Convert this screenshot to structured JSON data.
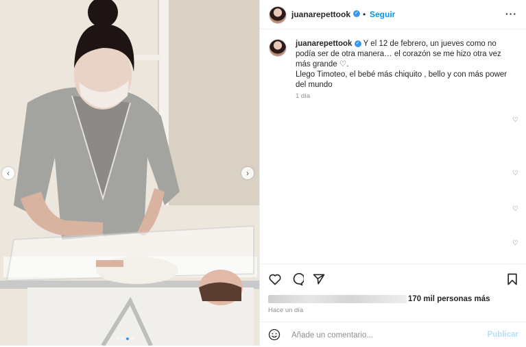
{
  "photo": {
    "prev_icon": "chevron-left-icon",
    "next_icon": "chevron-right-icon",
    "carousel": {
      "total": 4,
      "active_index": 2
    },
    "colors": {
      "wall": "#e9e2d8",
      "robe": "#9a9a9a",
      "hair": "#1e1414",
      "blanket": "#f5f3f0"
    }
  },
  "header": {
    "username": "juanarepettook",
    "verified_icon": "verified-badge-icon",
    "separator": "•",
    "follow_label": "Seguir",
    "more_label": "···"
  },
  "caption": {
    "username": "juanarepettook",
    "text_line1": "Y el 12 de febrero, un jueves como no podía ser de otra manera… el corazón se me hizo otra vez más grande ♡.",
    "text_line2": "Llego Timoteo, el bebé más chiquito , bello y con más power del mundo",
    "time": "1 día"
  },
  "comments": {
    "like_icon": "heart-outline-icon"
  },
  "actions": {
    "like_icon": "heart-icon",
    "comment_icon": "comment-icon",
    "share_icon": "share-icon",
    "save_icon": "bookmark-icon",
    "likes_text": "170 mil personas más",
    "time": "Hace un día"
  },
  "comment_bar": {
    "emoji_icon": "emoji-icon",
    "placeholder": "Añade un comentario...",
    "publish_label": "Publicar"
  },
  "colors": {
    "accent": "#0095f6",
    "verified": "#3897f0",
    "muted": "#8e8e8e",
    "publish_disabled": "#b2dffc"
  }
}
